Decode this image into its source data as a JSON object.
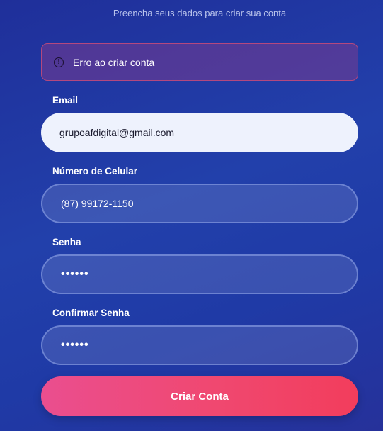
{
  "header": {
    "subtitle": "Preencha seus dados para criar sua conta"
  },
  "error": {
    "icon": "alert-circle-icon",
    "message": "Erro ao criar conta"
  },
  "form": {
    "email": {
      "label": "Email",
      "value": "grupoafdigital@gmail.com"
    },
    "phone": {
      "label": "Número de Celular",
      "value": "(87) 99172-1150"
    },
    "password": {
      "label": "Senha",
      "value": "••••••"
    },
    "confirm_password": {
      "label": "Confirmar Senha",
      "value": "••••••"
    },
    "submit_label": "Criar Conta"
  },
  "colors": {
    "background": "#2240ab",
    "error_border": "#b4487e",
    "button_start": "#ea4e8f",
    "button_end": "#f23d5c"
  }
}
